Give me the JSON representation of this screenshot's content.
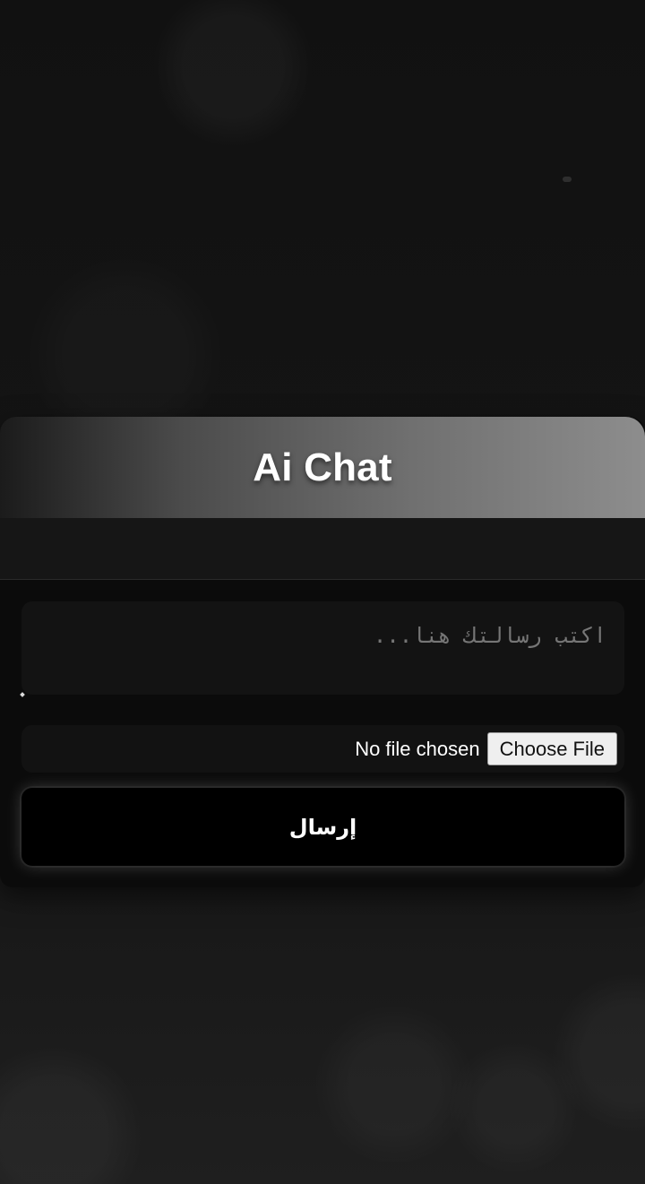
{
  "chat": {
    "title": "Ai Chat",
    "input": {
      "placeholder": "اكتب رسالتك هنا..."
    },
    "file": {
      "status": "No file chosen",
      "button_label": "Choose File"
    },
    "send_label": "إرسال"
  },
  "colors": {
    "background": "#151515",
    "card": "#0b0b0b",
    "header_gradient_start": "#1b1b1b",
    "header_gradient_end": "#8d8d8d",
    "button": "#000000",
    "text": "#ffffff"
  }
}
